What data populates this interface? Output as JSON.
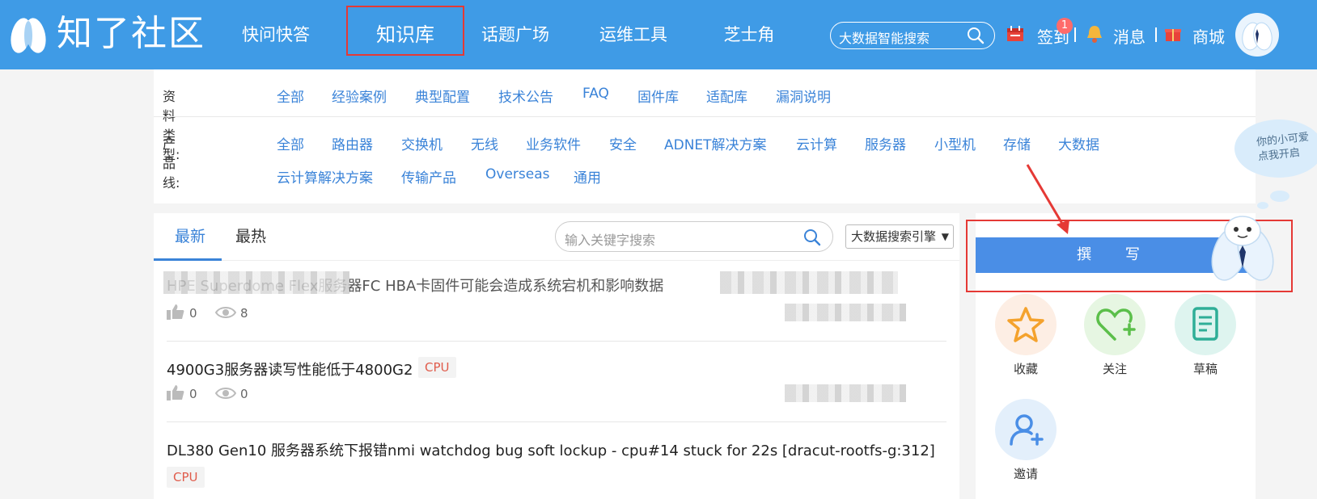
{
  "header": {
    "logo_text": "知了社区",
    "nav": [
      "快问快答",
      "知识库",
      "话题广场",
      "运维工具",
      "芝士角"
    ],
    "active_nav": "知识库",
    "search_placeholder": "大数据智能搜索",
    "signin_label": "签到",
    "signin_badge": "1",
    "messages_label": "消息",
    "mall_label": "商城"
  },
  "filters": {
    "type_label": "资料类型:",
    "types": [
      "全部",
      "经验案例",
      "典型配置",
      "技术公告",
      "FAQ",
      "固件库",
      "适配库",
      "漏洞说明"
    ],
    "product_label": "产品线:",
    "products_row1": [
      "全部",
      "路由器",
      "交换机",
      "无线",
      "业务软件",
      "安全",
      "ADNET解决方案",
      "云计算",
      "服务器",
      "小型机",
      "存储",
      "大数据"
    ],
    "products_row2": [
      "云计算解决方案",
      "传输产品",
      "Overseas",
      "通用"
    ]
  },
  "list": {
    "tabs": [
      "最新",
      "最热"
    ],
    "search_placeholder": "输入关键字搜索",
    "engine": "大数据搜索引擎",
    "articles": [
      {
        "title": "HPE Superdome Flex服务器FC HBA卡固件可能会造成系统宕机和影响数据",
        "likes": "0",
        "views": "8",
        "tag": ""
      },
      {
        "title": "4900G3服务器读写性能低于4800G2",
        "likes": "0",
        "views": "0",
        "tag": "CPU"
      },
      {
        "title": "DL380 Gen10 服务器系统下报错nmi watchdog bug soft lockup - cpu#14 stuck for 22s [dracut-rootfs-g:312]",
        "likes": "",
        "views": "",
        "tag": "CPU"
      }
    ]
  },
  "side": {
    "write_label": "撰 写",
    "actions": [
      "收藏",
      "关注",
      "草稿",
      "邀请"
    ],
    "mascot_bubble": "你的小可爱 点我开启"
  },
  "colors": {
    "header_bg": "#3f9be6",
    "link": "#3a83d8",
    "highlight": "#e53935",
    "write_button": "#4a8ee6"
  }
}
